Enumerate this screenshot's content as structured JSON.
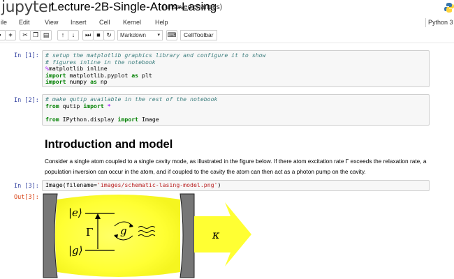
{
  "header": {
    "logo_text": "jupyter",
    "notebook_title": "Lecture-2B-Single-Atom-Lasing",
    "save_status": "(unsaved changes)"
  },
  "menu": {
    "items": [
      "ile",
      "Edit",
      "View",
      "Insert",
      "Cell",
      "Kernel",
      "Help"
    ],
    "kernel": "Python 3"
  },
  "toolbar": {
    "buttons": [
      "save",
      "add-cell",
      "cut",
      "copy",
      "paste",
      "move-up",
      "move-down",
      "run",
      "interrupt",
      "restart"
    ],
    "cell_type": "Markdown",
    "celltoolbar_label": "CellToolbar"
  },
  "cells": {
    "in1": {
      "prompt": "In [1]:",
      "lines": [
        "# setup the matplotlib graphics library and configure it to show",
        "# figures inline in the notebook",
        "%matplotlib inline",
        "import matplotlib.pyplot as plt",
        "import numpy as np"
      ]
    },
    "in2": {
      "prompt": "In [2]:",
      "lines": [
        "# make qutip available in the rest of the notebook",
        "from qutip import *",
        "",
        "from IPython.display import Image"
      ]
    },
    "md": {
      "heading": "Introduction and model",
      "paragraph": "Consider a single atom coupled to a single cavity mode, as illustrated in the figure below. If there atom excitation rate Γ exceeds the relaxation rate, a population inversion can occur in the atom, and if coupled to the cavity the atom can then act as a photon pump on the cavity."
    },
    "in3": {
      "prompt": "In [3]:",
      "code": "Image(filename='images/schematic-lasing-model.png')"
    },
    "out3": {
      "prompt": "Out[3]:",
      "figure_labels": {
        "excited": "|e⟩",
        "ground": "|g⟩",
        "gamma": "Γ",
        "coupling": "g",
        "kappa": "κ"
      }
    }
  },
  "colors": {
    "prompt_in": "#303f9f",
    "prompt_out": "#d84315",
    "figure_yellow": "#ffff33",
    "mirror_gray": "#777777"
  }
}
